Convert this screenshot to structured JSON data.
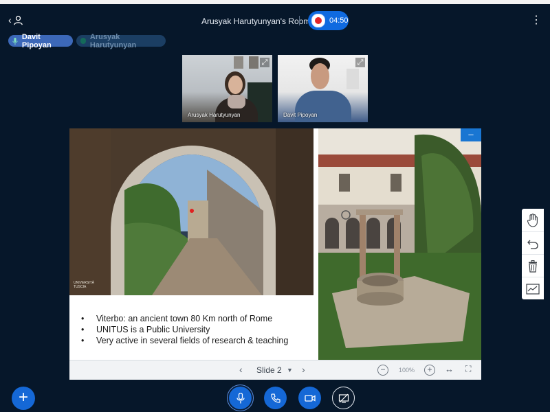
{
  "header": {
    "room_title": "Arusyak Harutyunyan's Room",
    "recording_time": "04:50"
  },
  "talkers": [
    {
      "name": "Davit Pipoyan",
      "active": true
    },
    {
      "name": "Arusyak Harutyunyan",
      "active": false
    }
  ],
  "videos": [
    {
      "name": "Arusyak Harutyunyan"
    },
    {
      "name": "Davit Pipoyan"
    }
  ],
  "presentation": {
    "bullets": [
      "Viterbo: an ancient town 80 Km north of Rome",
      "UNITUS is a Public University",
      "Very active in several fields of research & teaching"
    ],
    "bullet_char": "•",
    "logo_text": "UNIVERSITÀ TUSCIA",
    "slide_label": "Slide 2",
    "zoom": "100%",
    "minimize_label": "–"
  },
  "whiteboard_tools": [
    "hand-icon",
    "undo-icon",
    "trash-icon",
    "chart-icon"
  ],
  "action_bar": {
    "add_label": "+"
  },
  "colors": {
    "background": "#06172a",
    "accent": "#1568d6",
    "record": "#e3252a"
  }
}
